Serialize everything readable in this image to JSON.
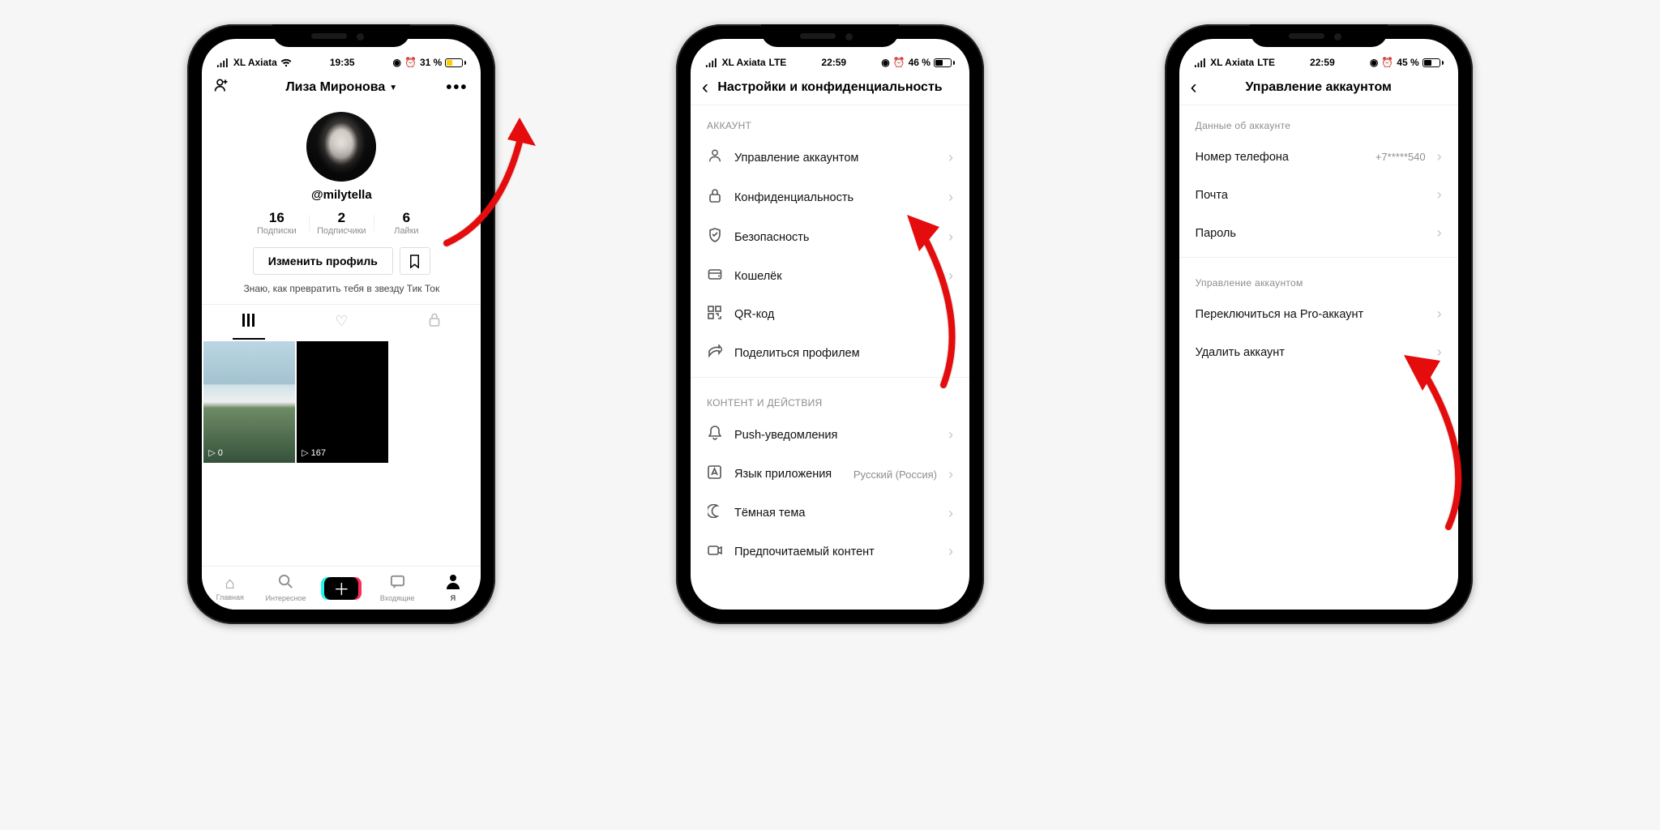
{
  "phone1": {
    "status": {
      "carrier": "XL Axiata",
      "net": "wifi",
      "time": "19:35",
      "alarm": true,
      "battery_pct": "31 %",
      "battery_fill": 31,
      "low_power": true
    },
    "header": {
      "name": "Лиза Миронова",
      "add_user": "adduser",
      "more": "…"
    },
    "profile": {
      "username": "@milytella",
      "stats": [
        {
          "num": "16",
          "label": "Подписки"
        },
        {
          "num": "2",
          "label": "Подписчики"
        },
        {
          "num": "6",
          "label": "Лайки"
        }
      ],
      "edit_btn": "Изменить профиль",
      "bio": "Знаю, как превратить тебя в звезду Тик Ток",
      "thumbs": [
        {
          "plays": "0"
        },
        {
          "plays": "167"
        }
      ]
    },
    "tabbar": {
      "home": "Главная",
      "discover": "Интересное",
      "inbox": "Входящие",
      "me": "Я"
    }
  },
  "phone2": {
    "status": {
      "carrier": "XL Axiata",
      "net": "LTE",
      "time": "22:59",
      "alarm": true,
      "battery_pct": "46 %",
      "battery_fill": 46
    },
    "title": "Настройки и конфиденциальность",
    "sections": {
      "account_title": "АККАУНТ",
      "account_items": [
        {
          "icon": "user",
          "label": "Управление аккаунтом"
        },
        {
          "icon": "lock",
          "label": "Конфиденциальность"
        },
        {
          "icon": "shield",
          "label": "Безопасность"
        },
        {
          "icon": "wallet",
          "label": "Кошелёк"
        },
        {
          "icon": "qr",
          "label": "QR-код"
        },
        {
          "icon": "share",
          "label": "Поделиться профилем"
        }
      ],
      "content_title": "КОНТЕНТ И ДЕЙСТВИЯ",
      "content_items": [
        {
          "icon": "bell",
          "label": "Push-уведомления"
        },
        {
          "icon": "lang",
          "label": "Язык приложения",
          "value": "Русский (Россия)"
        },
        {
          "icon": "moon",
          "label": "Тёмная тема"
        },
        {
          "icon": "camera",
          "label": "Предпочитаемый контент"
        }
      ]
    }
  },
  "phone3": {
    "status": {
      "carrier": "XL Axiata",
      "net": "LTE",
      "time": "22:59",
      "alarm": true,
      "battery_pct": "45 %",
      "battery_fill": 45
    },
    "title": "Управление аккаунтом",
    "sections": {
      "data_title": "Данные об аккаунте",
      "data_items": [
        {
          "label": "Номер телефона",
          "value": "+7*****540"
        },
        {
          "label": "Почта"
        },
        {
          "label": "Пароль"
        }
      ],
      "manage_title": "Управление аккаунтом",
      "manage_items": [
        {
          "label": "Переключиться на Pro-аккаунт"
        },
        {
          "label": "Удалить аккаунт"
        }
      ]
    }
  }
}
